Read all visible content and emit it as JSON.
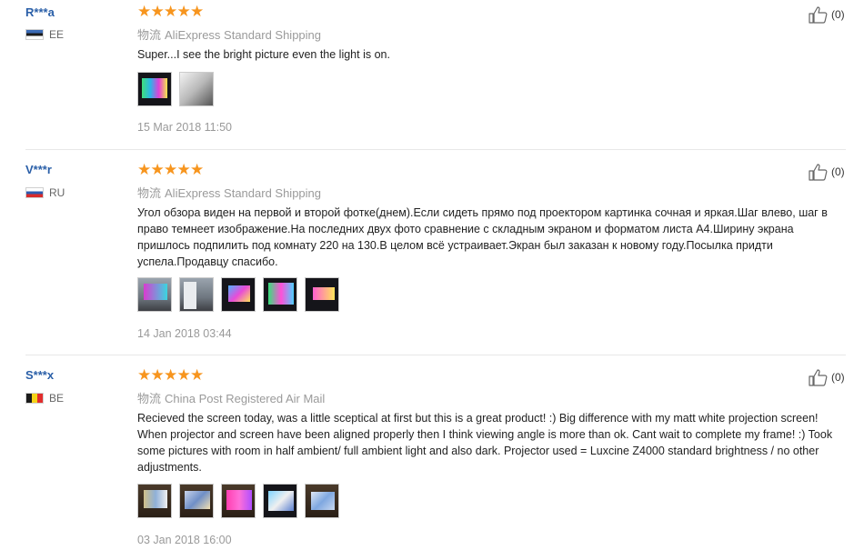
{
  "reviews": [
    {
      "user": "R***a",
      "country": "EE",
      "stars": 5,
      "shipping_prefix": "物流",
      "shipping": "AliExpress Standard Shipping",
      "text": "Super...I see the bright picture even the light is on.",
      "photo_count": 2,
      "date": "15 Mar 2018 11:50",
      "helpful": "(0)"
    },
    {
      "user": "V***r",
      "country": "RU",
      "stars": 5,
      "shipping_prefix": "物流",
      "shipping": "AliExpress Standard Shipping",
      "text": "Угол обзора виден на первой и второй фотке(днем).Если сидеть прямо под проектором картинка сочная и яркая.Шаг влево, шаг в право темнеет изображение.На последних двух фото сравнение с складным экраном и форматом листа А4.Ширину экрана пришлось подпилить под комнату 220 на 130.В целом всё устраивает.Экран был заказан к новому году.Посылка придти успела.Продавцу спасибо.",
      "photo_count": 5,
      "date": "14 Jan 2018 03:44",
      "helpful": "(0)"
    },
    {
      "user": "S***x",
      "country": "BE",
      "stars": 5,
      "shipping_prefix": "物流",
      "shipping": "China Post Registered Air Mail",
      "text": "Recieved the screen today, was a little sceptical at first but this is a great product! :) Big difference with my matt white projection screen! When projector and screen have been aligned properly then I think viewing angle is more than ok. Cant wait to complete my frame! :) Took some pictures with room in half ambient/ full ambient light and also dark. Projector used = Luxcine Z4000 standard brightness / no other adjustments.",
      "photo_count": 5,
      "date": "03 Jan 2018 16:00",
      "helpful": "(0)"
    }
  ],
  "colors": {
    "username": "#2a5fa8",
    "star": "#f7951e",
    "muted": "#999999"
  },
  "icons": {
    "helpful": "thumbs-up-icon",
    "star": "star-icon"
  }
}
